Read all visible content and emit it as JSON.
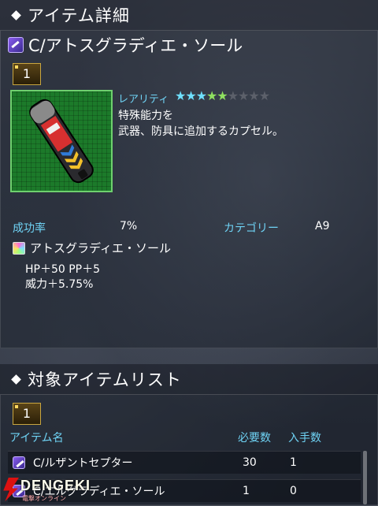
{
  "detail": {
    "header_title": "アイテム詳細",
    "item_name": "C/アトスグラディエ・ソール",
    "badge_count": "1",
    "rarity_label": "レアリティ",
    "stars_filled": "★★★★★",
    "stars_empty": "★★★★",
    "rarity_value": "5 of 9",
    "description_line1": "特殊能力を",
    "description_line2": "武器、防具に追加するカプセル。",
    "success_label": "成功率",
    "success_value": "7%",
    "category_label": "カテゴリー",
    "category_value": "A9",
    "ability_name": "アトスグラディエ・ソール",
    "ability_line1": "HP＋50 PP＋5",
    "ability_line2": "威力＋5.75%"
  },
  "list": {
    "header_title": "対象アイテムリスト",
    "badge_count": "1",
    "col_name": "アイテム名",
    "col_required": "必要数",
    "col_owned": "入手数",
    "rows": [
      {
        "name": "C/ルザントセプター",
        "required": "30",
        "owned": "1"
      },
      {
        "name": "C/エルグラディエ・ソール",
        "required": "1",
        "owned": "0"
      }
    ]
  },
  "watermark": {
    "text": "DENGEKI",
    "sub": "電撃オンライン"
  },
  "colors": {
    "accent_blue": "#6fd3f5",
    "star_on": "#6fe0ff",
    "star_green": "#8fe060",
    "star_off": "#5c606a"
  }
}
